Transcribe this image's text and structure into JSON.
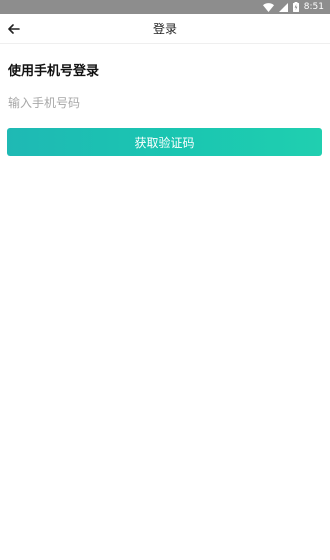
{
  "status_bar": {
    "time": "8:51",
    "background": "#8d8d8d",
    "icons": [
      "wifi-icon",
      "cellular-signal-icon",
      "battery-charging-icon"
    ]
  },
  "header": {
    "back_icon": "arrow-left-icon",
    "title": "登录"
  },
  "login": {
    "heading": "使用手机号登录",
    "phone_placeholder": "输入手机号码",
    "phone_value": "",
    "submit_label": "获取验证码",
    "accent_color": "#1ac6b1"
  }
}
